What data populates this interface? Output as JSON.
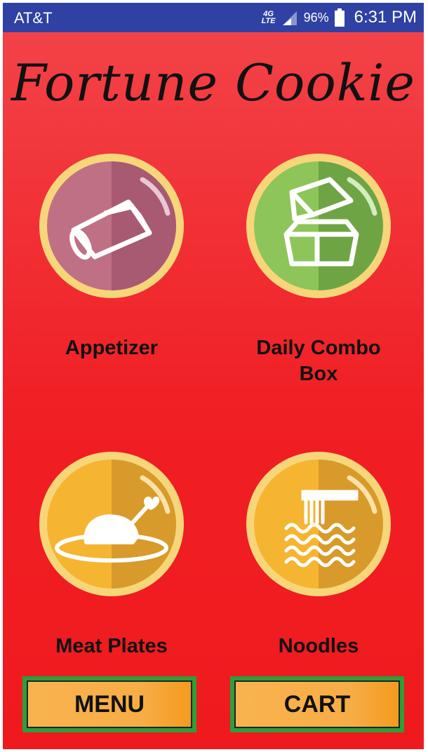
{
  "status_bar": {
    "carrier": "AT&T",
    "network": "4G",
    "network_sub": "LTE",
    "battery": "96%",
    "time": "6:31 PM"
  },
  "app": {
    "title": "Fortune Cookie"
  },
  "categories": [
    {
      "label": "Appetizer",
      "icon": "egg-roll-icon",
      "color": "#c07085"
    },
    {
      "label": "Daily Combo Box",
      "label_line1": "Daily Combo",
      "label_line2": "Box",
      "icon": "takeout-box-icon",
      "color": "#8dc55a"
    },
    {
      "label": "Meat Plates",
      "icon": "roast-chicken-icon",
      "color": "#f6b531"
    },
    {
      "label": "Noodles",
      "icon": "noodles-icon",
      "color": "#f6b531"
    }
  ],
  "buttons": {
    "menu": "MENU",
    "cart": "CART"
  },
  "colors": {
    "status_bar": "#2f41a3",
    "background": "#f02a2e",
    "button": "#f8b34f",
    "button_border": "#2d9e3a",
    "ring": "#f7d67a"
  }
}
